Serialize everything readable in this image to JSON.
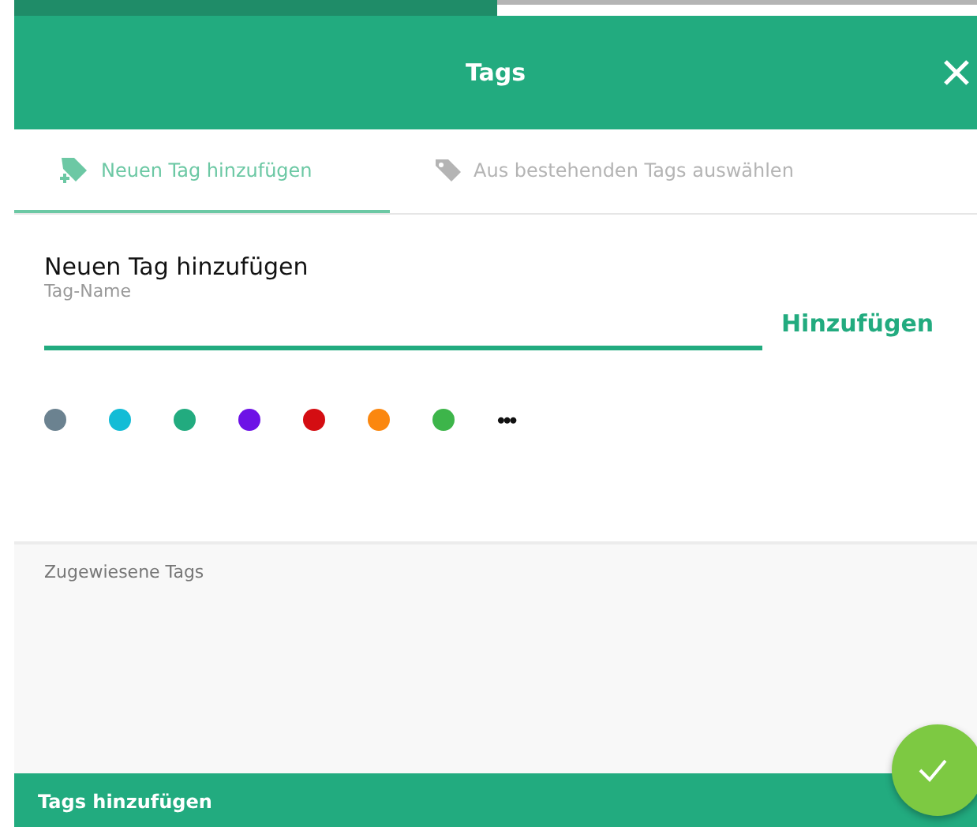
{
  "header": {
    "title": "Tags"
  },
  "tabs": [
    {
      "label": "Neuen Tag hinzufügen",
      "kind": "new",
      "selected": true
    },
    {
      "label": "Aus bestehenden Tags auswählen",
      "kind": "existing",
      "selected": false
    }
  ],
  "new_tag": {
    "heading": "Neuen Tag hinzufügen",
    "field_label": "Tag-Name",
    "add_button": "Hinzufügen",
    "colors": [
      {
        "color": "#6b8290"
      },
      {
        "color": "#13bcd6"
      },
      {
        "color": "#22ab7f"
      },
      {
        "color": "#6d12e6"
      },
      {
        "color": "#d40d12"
      },
      {
        "color": "#fb870f"
      },
      {
        "color": "#3db54a"
      }
    ],
    "more": "•••"
  },
  "assigned": {
    "label": "Zugewiesene Tags"
  },
  "footer": {
    "label": "Tags hinzufügen"
  }
}
